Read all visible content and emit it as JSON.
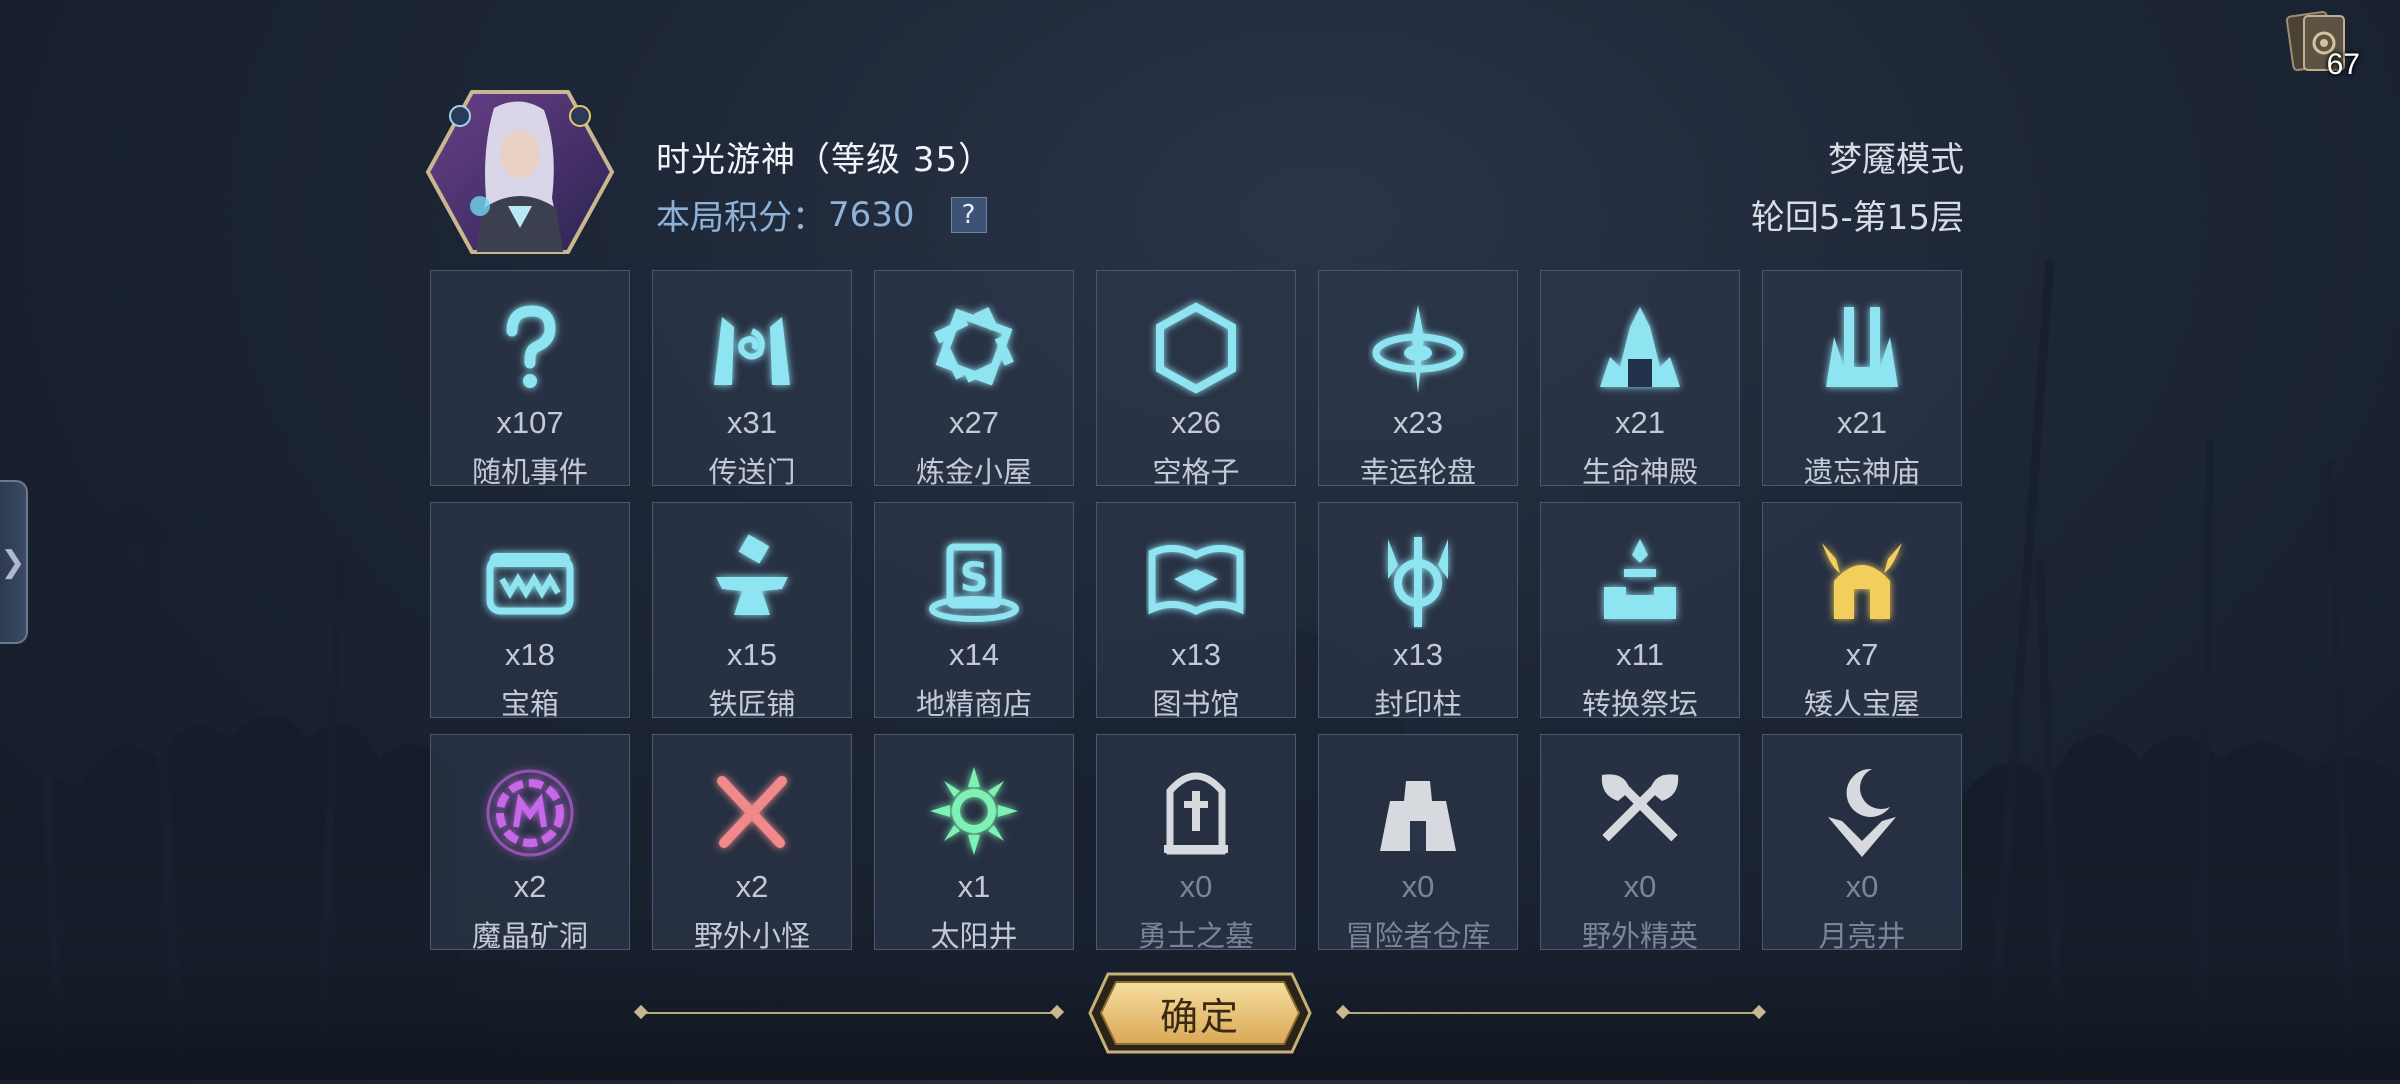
{
  "player": {
    "name": "时光游神（等级 35）",
    "score_label": "本局积分：",
    "score": "7630",
    "help": "?"
  },
  "game": {
    "mode": "梦魇模式",
    "floor": "轮回5-第15层"
  },
  "deck": {
    "count": "67",
    "icon": "card-deck-icon"
  },
  "events": [
    {
      "count": "x107",
      "label": "随机事件",
      "icon": "question-mark-icon",
      "color": "#8fe4f2"
    },
    {
      "count": "x31",
      "label": "传送门",
      "icon": "portal-gate-icon",
      "color": "#8fe4f2"
    },
    {
      "count": "x27",
      "label": "炼金小屋",
      "icon": "alchemy-icon",
      "color": "#8fe4f2"
    },
    {
      "count": "x26",
      "label": "空格子",
      "icon": "hexagon-icon",
      "color": "#8fe4f2"
    },
    {
      "count": "x23",
      "label": "幸运轮盘",
      "icon": "fortune-wheel-icon",
      "color": "#8fe4f2"
    },
    {
      "count": "x21",
      "label": "生命神殿",
      "icon": "life-temple-icon",
      "color": "#8fe4f2"
    },
    {
      "count": "x21",
      "label": "遗忘神庙",
      "icon": "forgotten-temple-icon",
      "color": "#8fe4f2"
    },
    {
      "count": "x18",
      "label": "宝箱",
      "icon": "treasure-chest-icon",
      "color": "#8fe4f2"
    },
    {
      "count": "x15",
      "label": "铁匠铺",
      "icon": "anvil-icon",
      "color": "#8fe4f2"
    },
    {
      "count": "x14",
      "label": "地精商店",
      "icon": "goblin-shop-icon",
      "color": "#8fe4f2"
    },
    {
      "count": "x13",
      "label": "图书馆",
      "icon": "book-icon",
      "color": "#8fe4f2"
    },
    {
      "count": "x13",
      "label": "封印柱",
      "icon": "seal-pillar-icon",
      "color": "#8fe4f2"
    },
    {
      "count": "x11",
      "label": "转换祭坛",
      "icon": "altar-icon",
      "color": "#8fe4f2"
    },
    {
      "count": "x7",
      "label": "矮人宝屋",
      "icon": "dwarf-helmet-icon",
      "color": "#f2cf5c"
    },
    {
      "count": "x2",
      "label": "魔晶矿洞",
      "icon": "crystal-mine-icon",
      "color": "#c768e8"
    },
    {
      "count": "x2",
      "label": "野外小怪",
      "icon": "crossed-swords-icon",
      "color": "#f08a8a"
    },
    {
      "count": "x1",
      "label": "太阳井",
      "icon": "sun-well-icon",
      "color": "#7ef2b4"
    },
    {
      "count": "x0",
      "label": "勇士之墓",
      "icon": "tomb-icon",
      "color": "#d6d9de"
    },
    {
      "count": "x0",
      "label": "冒险者仓库",
      "icon": "warehouse-icon",
      "color": "#d6d9de"
    },
    {
      "count": "x0",
      "label": "野外精英",
      "icon": "crossed-axes-icon",
      "color": "#d6d9de"
    },
    {
      "count": "x0",
      "label": "月亮井",
      "icon": "moon-well-icon",
      "color": "#d6d9de"
    }
  ],
  "confirm": {
    "label": "确定"
  }
}
